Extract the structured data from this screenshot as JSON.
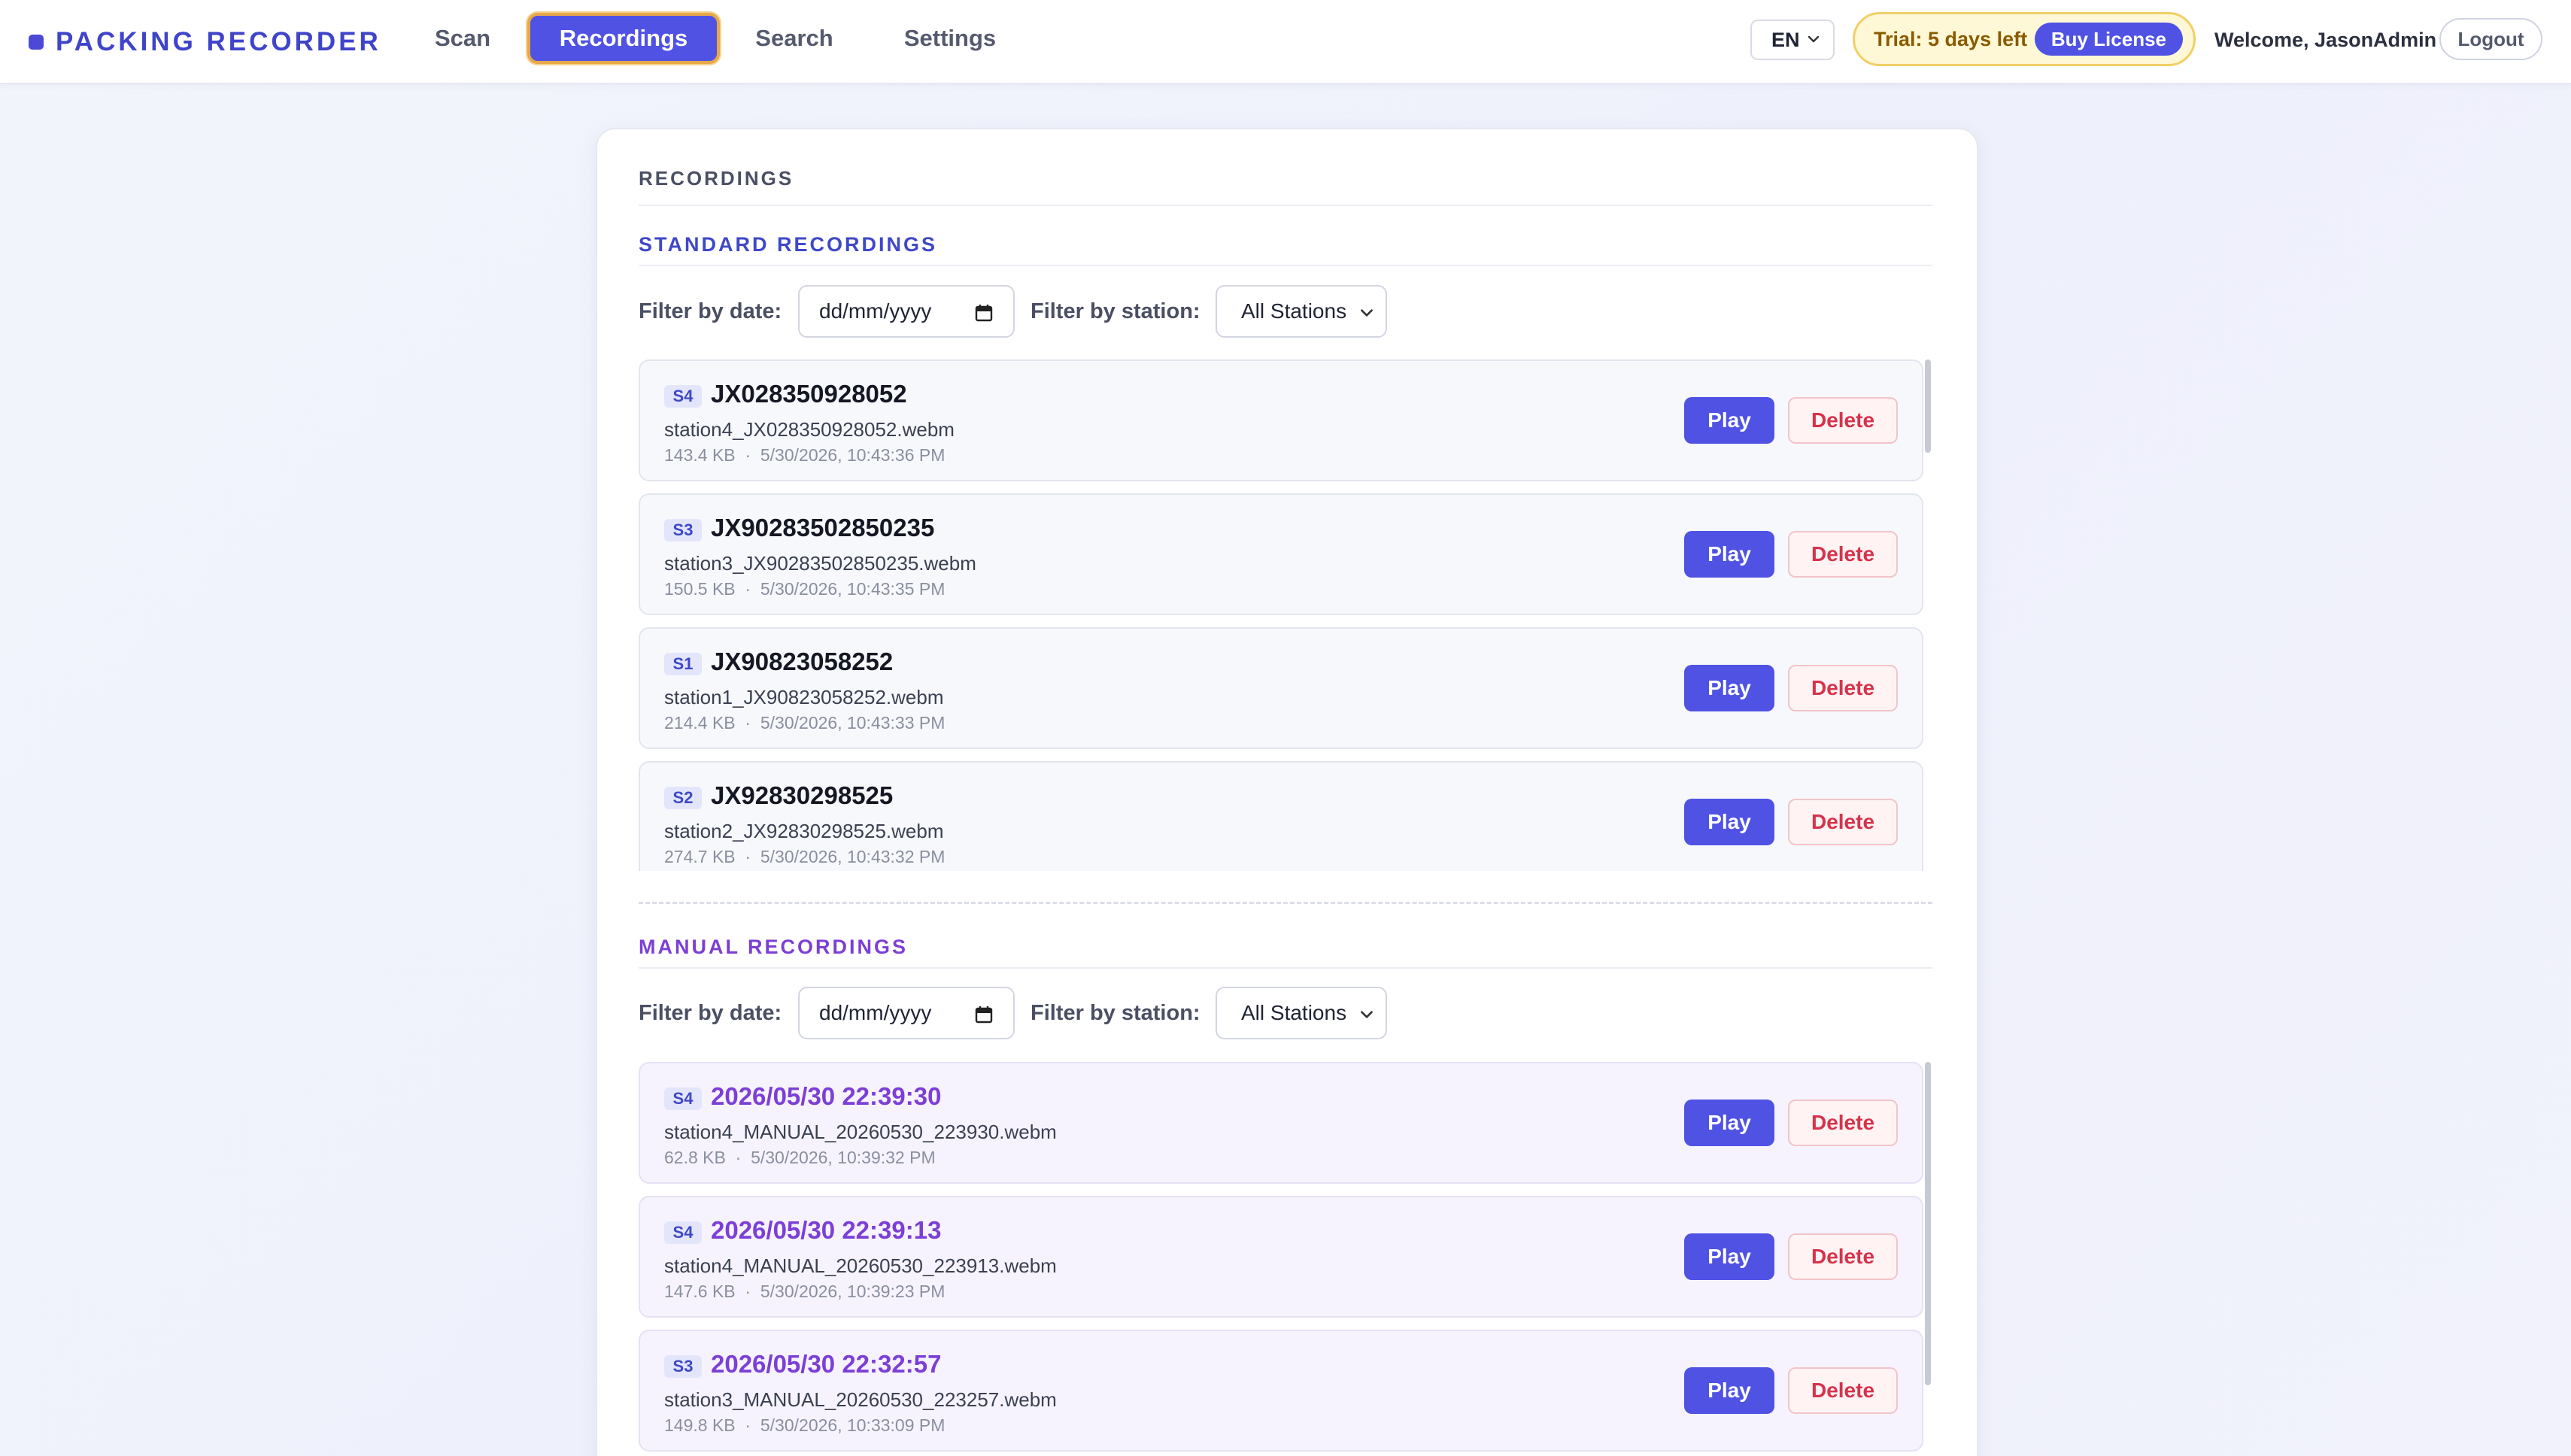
{
  "brand": {
    "title": "PACKING RECORDER"
  },
  "nav": {
    "tabs": [
      {
        "label": "Scan",
        "active": false
      },
      {
        "label": "Recordings",
        "active": true
      },
      {
        "label": "Search",
        "active": false
      },
      {
        "label": "Settings",
        "active": false
      }
    ],
    "language": "EN",
    "trial_text": "Trial: 5 days left",
    "buy_label": "Buy License",
    "welcome": "Welcome, JasonAdmin",
    "logout_label": "Logout"
  },
  "page": {
    "title": "RECORDINGS"
  },
  "standard": {
    "title": "STANDARD RECORDINGS",
    "date_label": "Filter by date:",
    "date_placeholder": "dd/mm/yyyy",
    "station_label": "Filter by station:",
    "station_value": "All Stations",
    "items": [
      {
        "badge": "S4",
        "title": "JX028350928052",
        "file": "station4_JX028350928052.webm",
        "size": "143.4 KB",
        "time": "5/30/2026, 10:43:36 PM"
      },
      {
        "badge": "S3",
        "title": "JX90283502850235",
        "file": "station3_JX90283502850235.webm",
        "size": "150.5 KB",
        "time": "5/30/2026, 10:43:35 PM"
      },
      {
        "badge": "S1",
        "title": "JX90823058252",
        "file": "station1_JX90823058252.webm",
        "size": "214.4 KB",
        "time": "5/30/2026, 10:43:33 PM"
      },
      {
        "badge": "S2",
        "title": "JX92830298525",
        "file": "station2_JX92830298525.webm",
        "size": "274.7 KB",
        "time": "5/30/2026, 10:43:32 PM"
      }
    ]
  },
  "manual": {
    "title": "MANUAL RECORDINGS",
    "date_label": "Filter by date:",
    "date_placeholder": "dd/mm/yyyy",
    "station_label": "Filter by station:",
    "station_value": "All Stations",
    "items": [
      {
        "badge": "S4",
        "title": "2026/05/30 22:39:30",
        "file": "station4_MANUAL_20260530_223930.webm",
        "size": "62.8 KB",
        "time": "5/30/2026, 10:39:32 PM"
      },
      {
        "badge": "S4",
        "title": "2026/05/30 22:39:13",
        "file": "station4_MANUAL_20260530_223913.webm",
        "size": "147.6 KB",
        "time": "5/30/2026, 10:39:23 PM"
      },
      {
        "badge": "S3",
        "title": "2026/05/30 22:32:57",
        "file": "station3_MANUAL_20260530_223257.webm",
        "size": "149.8 KB",
        "time": "5/30/2026, 10:33:09 PM"
      }
    ]
  },
  "actions": {
    "play_label": "Play",
    "delete_label": "Delete",
    "meta_separator": "·"
  },
  "colors": {
    "accent": "#4f52e3",
    "standard_title": "#3f48c7",
    "manual_title": "#7c3fd6",
    "danger": "#d6334b",
    "trial_border": "#f2cf66"
  }
}
